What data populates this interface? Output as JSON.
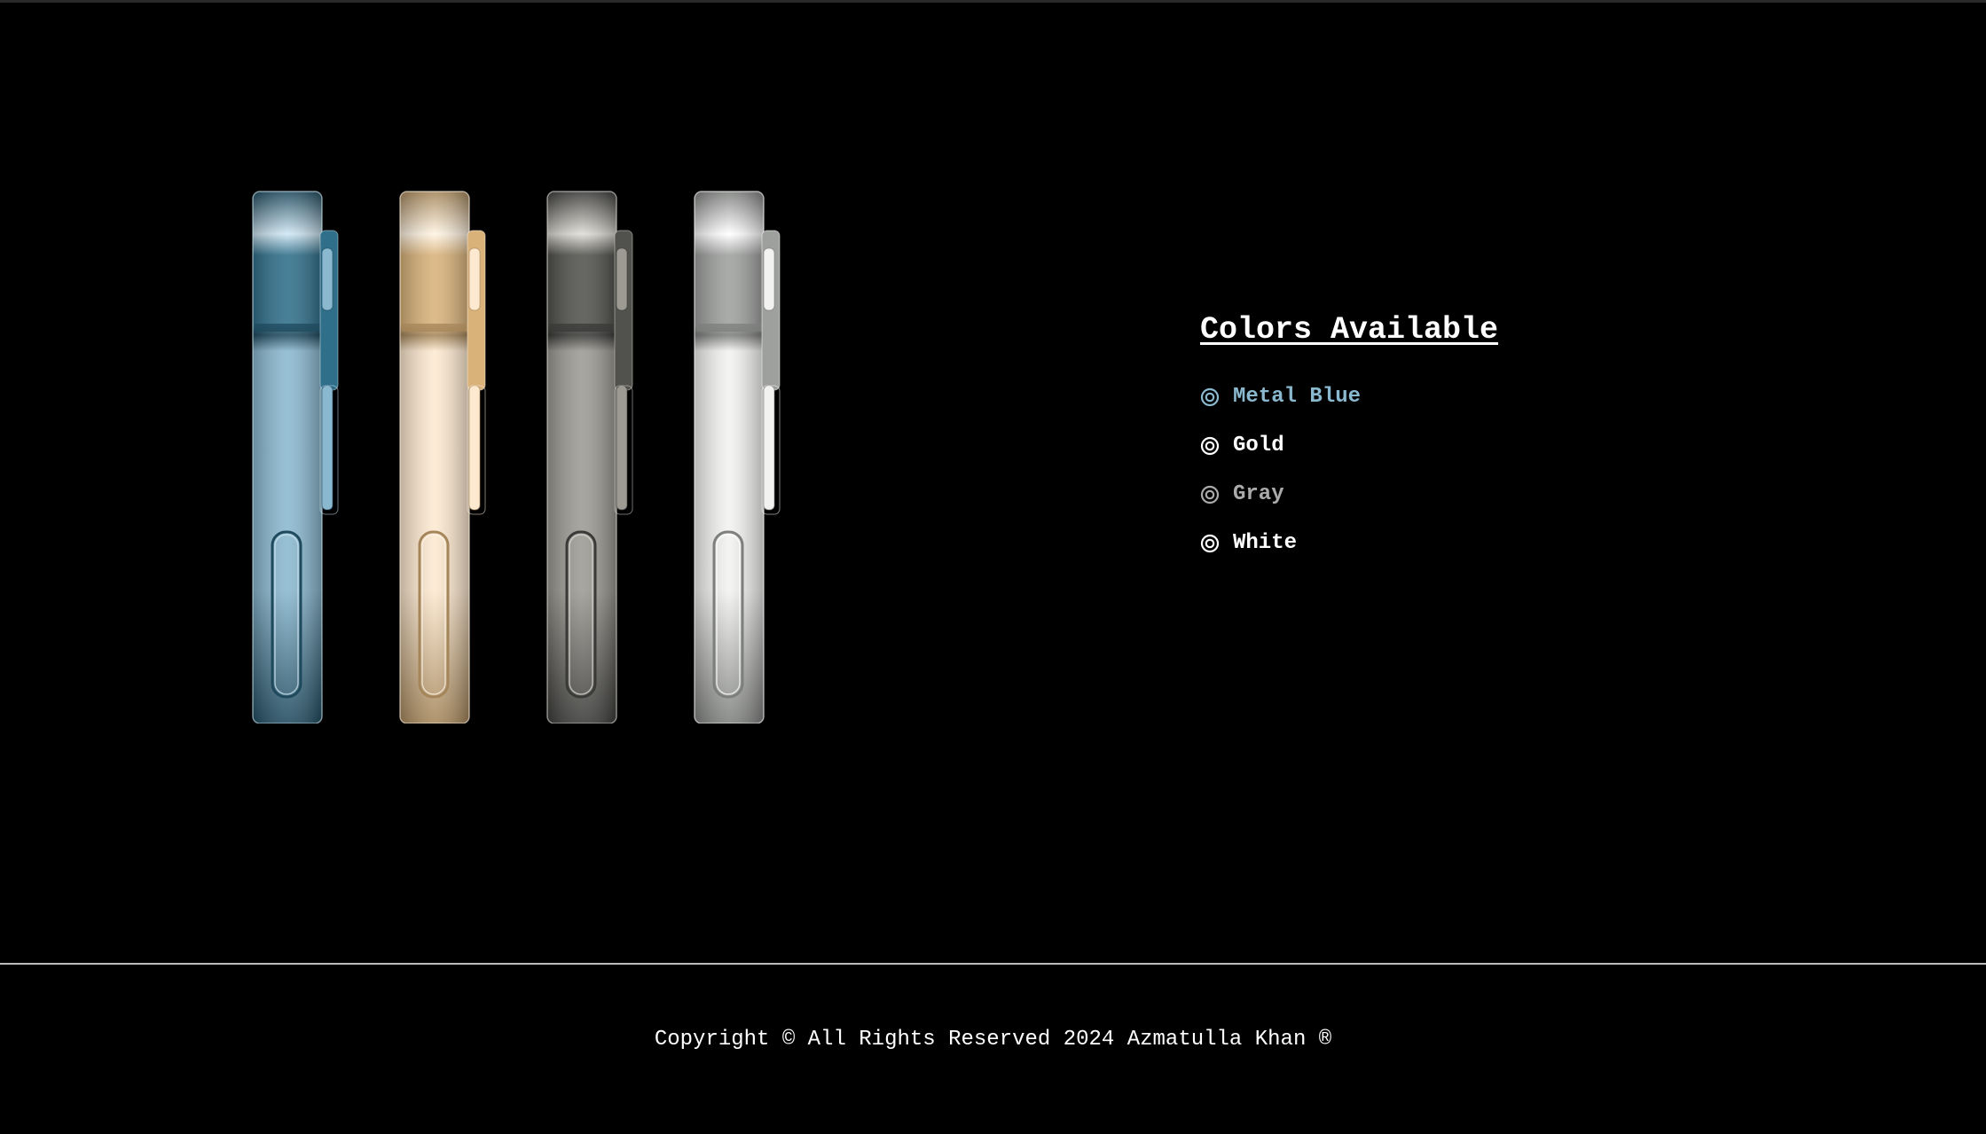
{
  "phones": [
    {
      "name": "Metal Blue",
      "frame": "#1f4a5e",
      "body_top": "#2f6f8a",
      "body": "#8ab8cf",
      "edge": "#cfe7f3"
    },
    {
      "name": "Gold",
      "frame": "#a5865a",
      "body_top": "#d9b27a",
      "body": "#fde9d0",
      "edge": "#fff4e3"
    },
    {
      "name": "Gray",
      "frame": "#3a3a38",
      "body_top": "#51514d",
      "body": "#9c9a93",
      "edge": "#dedcd5"
    },
    {
      "name": "White",
      "frame": "#7d7f7d",
      "body_top": "#9ea09e",
      "body": "#f2f3f1",
      "edge": "#ffffff"
    }
  ],
  "colors": {
    "title": "Colors Available",
    "items": [
      {
        "label": "Metal Blue",
        "color": "#8ab8cf"
      },
      {
        "label": "Gold",
        "color": "#ffffff"
      },
      {
        "label": "Gray",
        "color": "#aaaaaa"
      },
      {
        "label": "White",
        "color": "#ffffff"
      }
    ]
  },
  "footer": {
    "text": "Copyright © All Rights Reserved 2024 Azmatulla Khan ®"
  }
}
